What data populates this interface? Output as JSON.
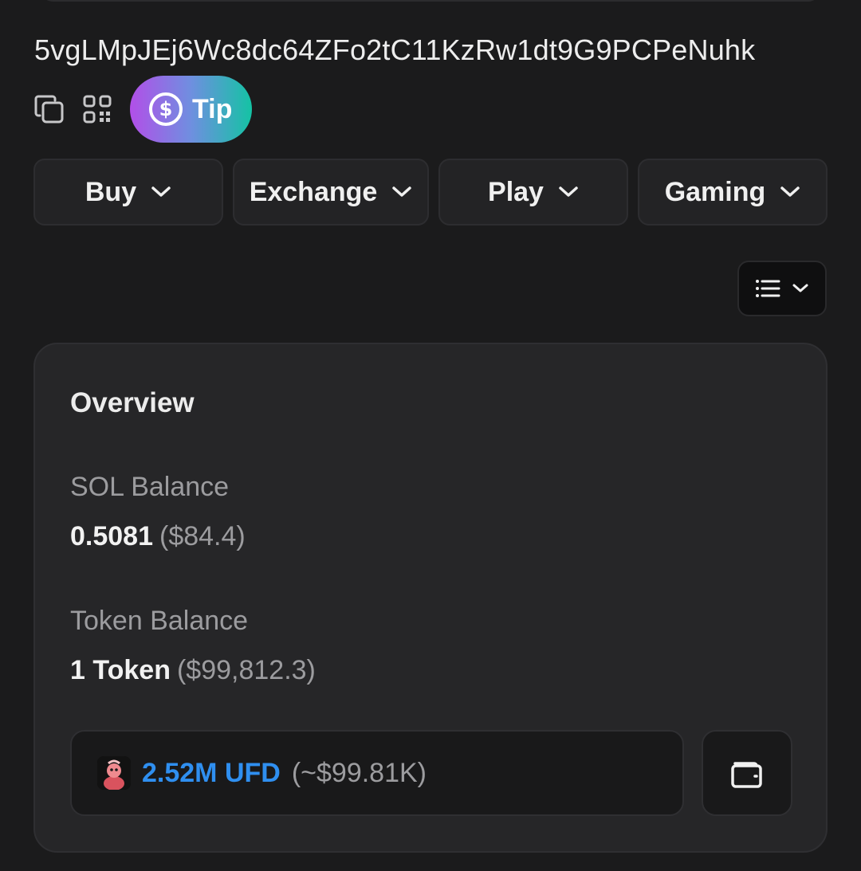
{
  "account": {
    "address": "5vgLMpJEj6Wc8dc64ZFo2tC11KzRw1dt9G9PCPeNuhk",
    "tip_label": "Tip"
  },
  "icons": {
    "copy": "copy-icon",
    "qr": "qr-code-icon",
    "tip": "dollar-circle-icon",
    "chevron": "chevron-down-icon",
    "list": "list-icon",
    "wallet": "wallet-icon",
    "token": "token-avatar-icon"
  },
  "menu": {
    "items": [
      {
        "label": "Buy"
      },
      {
        "label": "Exchange"
      },
      {
        "label": "Play"
      },
      {
        "label": "Gaming"
      }
    ]
  },
  "overview": {
    "title": "Overview",
    "sol_balance": {
      "label": "SOL Balance",
      "amount": "0.5081",
      "usd": "($84.4)"
    },
    "token_balance": {
      "label": "Token Balance",
      "amount": "1 Token",
      "usd": "($99,812.3)"
    },
    "token_selector": {
      "amount": "2.52M UFD",
      "usd": "(~$99.81K)"
    }
  },
  "colors": {
    "background": "#1b1b1c",
    "card": "#262628",
    "accent_blue": "#2f8ff0",
    "tip_gradient_start": "#b24fe8",
    "tip_gradient_end": "#14c3a4"
  }
}
